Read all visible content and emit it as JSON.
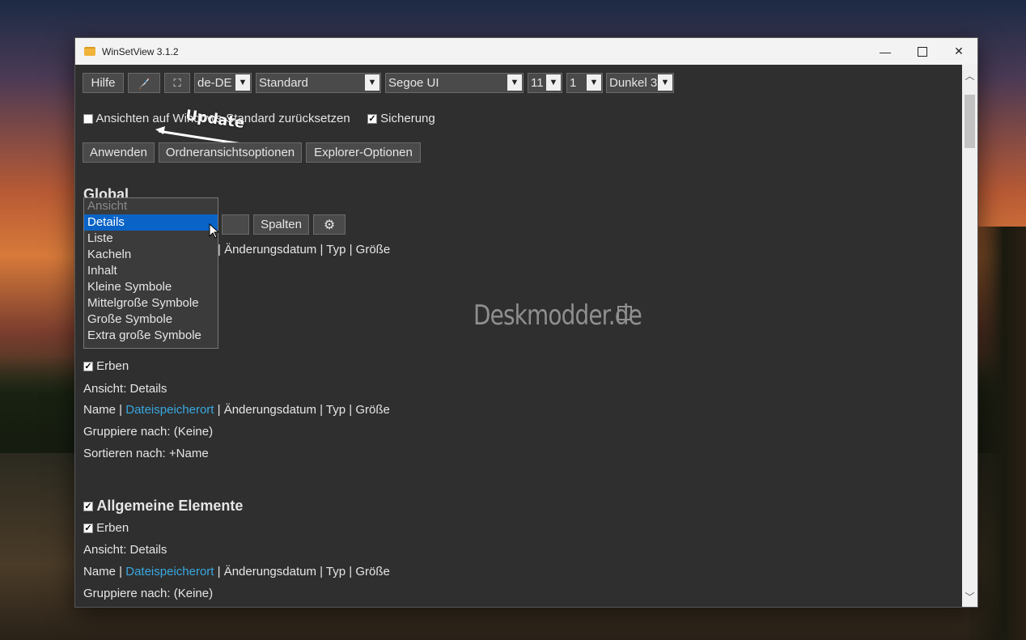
{
  "window": {
    "title": "WinSetView 3.1.2"
  },
  "toolbar": {
    "help_label": "Hilfe",
    "rocket_icon": "rocket-icon",
    "fullscreen_glyph": "⛶",
    "language": "de-DE",
    "view_preset": "Standard",
    "font": "Segoe UI",
    "font_size": "11",
    "option_num": "1",
    "theme": "Dunkel 3",
    "annotation_update": "Update"
  },
  "options": {
    "reset_label": "Ansichten auf Windows-Standard zurücksetzen",
    "reset_checked": false,
    "backup_label": "Sicherung",
    "backup_checked": true
  },
  "actions": {
    "apply": "Anwenden",
    "folder_options": "Ordneransichtsoptionen",
    "explorer_options": "Explorer-Optionen"
  },
  "global": {
    "heading": "Global",
    "columns_button": "Spalten",
    "columns_tail": "| Änderungsdatum | Typ | Größe"
  },
  "view_dropdown": {
    "items": [
      "Ansicht",
      "Details",
      "Liste",
      "Kacheln",
      "Inhalt",
      "Kleine Symbole",
      "Mittelgroße Symbole",
      "Große Symbole",
      "Extra große Symbole"
    ],
    "selected": "Details"
  },
  "section_downloads": {
    "inherit_label": "Erben",
    "view_line": "Ansicht: Details",
    "columns_name": "Name |",
    "columns_link": "Dateispeicherort",
    "columns_rest": "| Änderungsdatum | Typ | Größe",
    "group_line": "Gruppiere nach: (Keine)",
    "sort_line": "Sortieren nach: +Name"
  },
  "section_general": {
    "heading": "Allgemeine Elemente",
    "inherit_label": "Erben",
    "view_line": "Ansicht: Details",
    "columns_name": "Name |",
    "columns_link": "Dateispeicherort",
    "columns_rest": "| Änderungsdatum | Typ | Größe",
    "group_line": "Gruppiere nach: (Keine)"
  },
  "watermark": "Deskmodder.de",
  "colors": {
    "accent": "#0a64c8",
    "link": "#38a8e0",
    "window_bg": "#2f2f2f"
  }
}
